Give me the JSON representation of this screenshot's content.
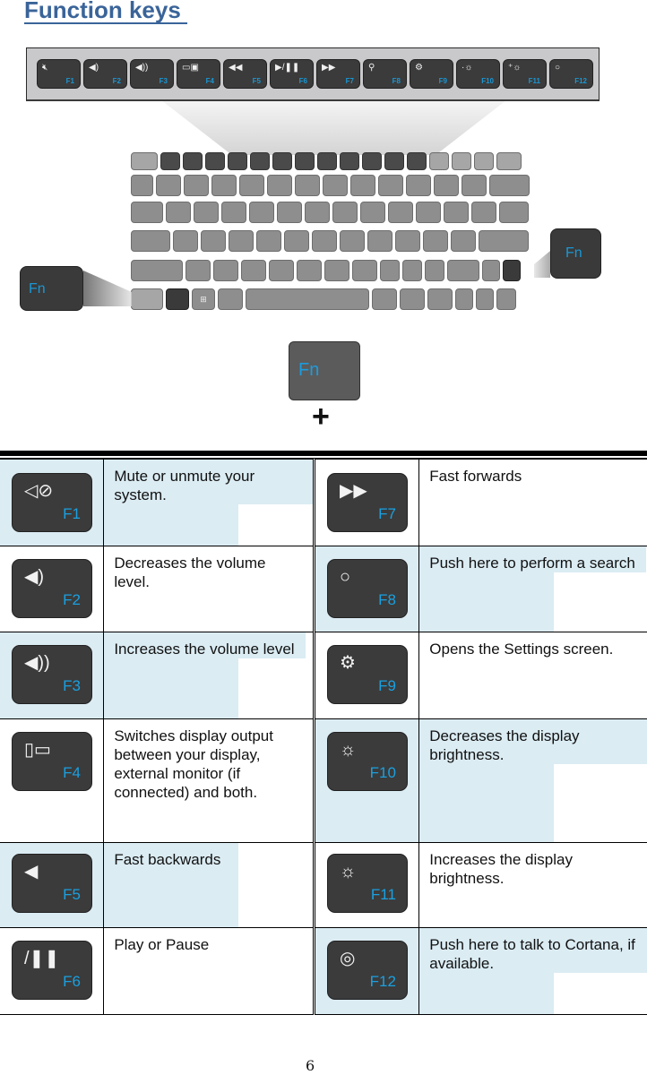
{
  "page": {
    "title": "Function keys ",
    "page_number": "6"
  },
  "function_strip": {
    "keys": [
      {
        "label": "F1",
        "icon": "mute-icon",
        "glyph": "🔇︎"
      },
      {
        "label": "F2",
        "icon": "volume-down-icon",
        "glyph": "◀)"
      },
      {
        "label": "F3",
        "icon": "volume-up-icon",
        "glyph": "◀))"
      },
      {
        "label": "F4",
        "icon": "display-switch-icon",
        "glyph": "▭▣"
      },
      {
        "label": "F5",
        "icon": "rewind-icon",
        "glyph": "◀◀"
      },
      {
        "label": "F6",
        "icon": "play-pause-icon",
        "glyph": "▶/❚❚"
      },
      {
        "label": "F7",
        "icon": "fast-forward-icon",
        "glyph": "▶▶"
      },
      {
        "label": "F8",
        "icon": "search-icon",
        "glyph": "⚲"
      },
      {
        "label": "F9",
        "icon": "gear-icon",
        "glyph": "⚙"
      },
      {
        "label": "F10",
        "icon": "brightness-down-icon",
        "glyph": "·☼"
      },
      {
        "label": "F11",
        "icon": "brightness-up-icon",
        "glyph": "⁺☼"
      },
      {
        "label": "F12",
        "icon": "cortana-icon",
        "glyph": "○"
      }
    ]
  },
  "callouts": {
    "fn_left": "Fn",
    "fn_right": "Fn",
    "fn_main": "Fn",
    "plus": "+",
    "windows_glyph": "⊞"
  },
  "colors": {
    "title": "#3a6499",
    "key_label": "#1a97d4",
    "highlight": "#dbecf3",
    "key_body": "#3b3b3b"
  },
  "table": {
    "rows": [
      {
        "left": {
          "key": "F1",
          "icon": "mute-icon",
          "glyph": "◁⊘",
          "description": "Mute or unmute your system."
        },
        "right": {
          "key": "F7",
          "icon": "fast-forward-icon",
          "glyph": "▶▶",
          "description": "Fast forwards"
        }
      },
      {
        "left": {
          "key": "F2",
          "icon": "volume-down-icon",
          "glyph": "◀)",
          "description": "Decreases the volume level."
        },
        "right": {
          "key": "F8",
          "icon": "search-icon",
          "glyph": "○",
          "description": "Push here to perform a search"
        }
      },
      {
        "left": {
          "key": "F3",
          "icon": "volume-up-icon",
          "glyph": "◀))",
          "description": "Increases the volume level"
        },
        "right": {
          "key": "F9",
          "icon": "gear-icon",
          "glyph": "⚙",
          "description": "Opens the Settings screen."
        }
      },
      {
        "left": {
          "key": "F4",
          "icon": "display-switch-icon",
          "glyph": "▯▭",
          "description": "Switches display output between your display, external monitor (if connected) and both."
        },
        "right": {
          "key": "F10",
          "icon": "brightness-down-icon",
          "glyph": "☼",
          "description": "Decreases the display brightness."
        }
      },
      {
        "left": {
          "key": "F5",
          "icon": "rewind-icon",
          "glyph": "◀",
          "description": "Fast backwards"
        },
        "right": {
          "key": "F11",
          "icon": "brightness-up-icon",
          "glyph": "☼",
          "description": "Increases the display brightness."
        }
      },
      {
        "left": {
          "key": "F6",
          "icon": "play-pause-icon",
          "glyph": "/❚❚",
          "description": "Play or Pause"
        },
        "right": {
          "key": "F12",
          "icon": "cortana-icon",
          "glyph": "◎",
          "description": "Push here to talk to Cortana, if available."
        }
      }
    ]
  }
}
